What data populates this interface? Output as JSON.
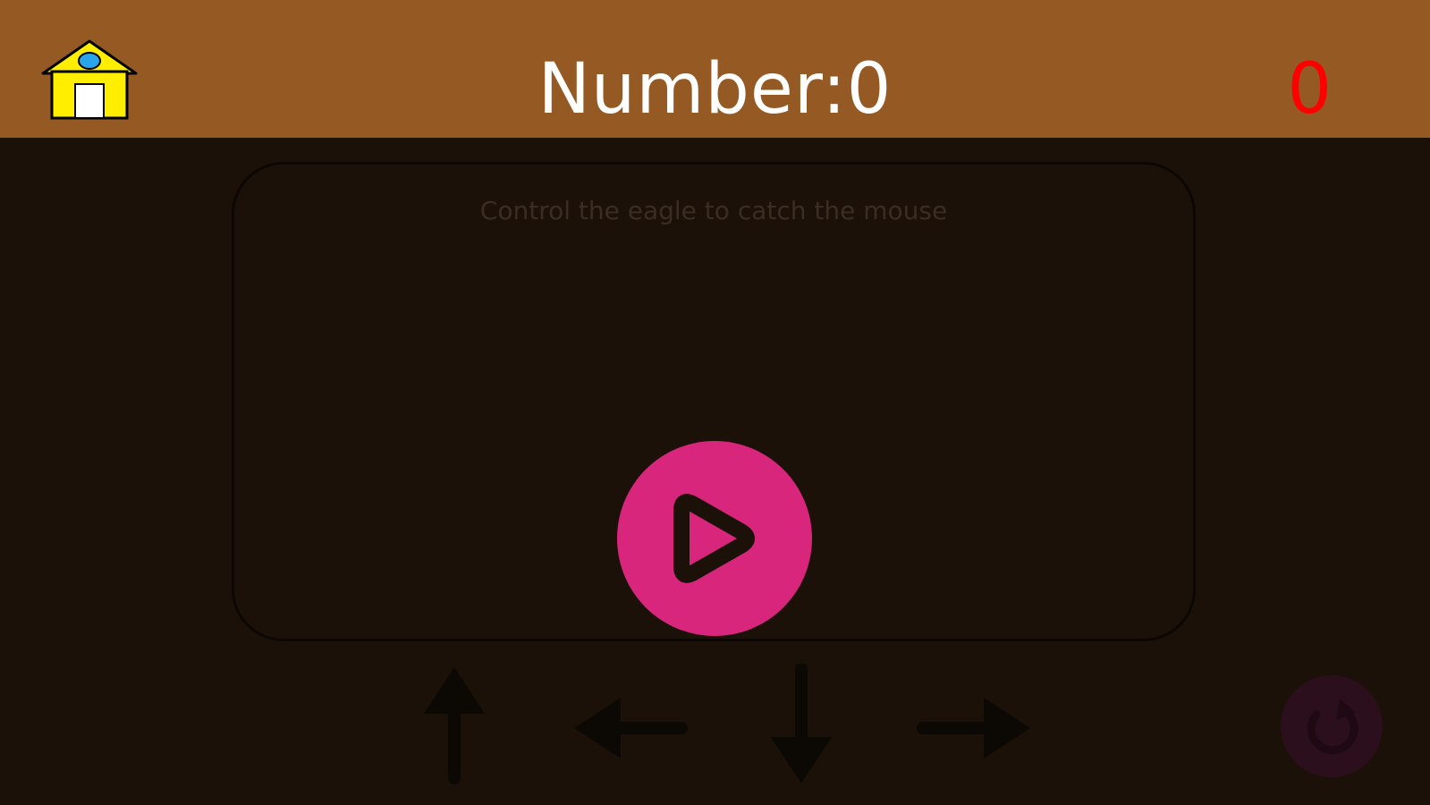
{
  "header": {
    "title": "Number:0",
    "score": "0",
    "home_icon": "home-icon"
  },
  "board": {
    "instruction": "Control the eagle to catch the mouse"
  },
  "controls": {
    "play_icon": "play-icon",
    "arrows": [
      "arrow-up-icon",
      "arrow-left-icon",
      "arrow-down-icon",
      "arrow-right-icon"
    ],
    "reset_icon": "reset-icon"
  },
  "colors": {
    "topbar": "#955a24",
    "background": "#1c1108",
    "play_button": "#d8267c",
    "score": "#ff0000"
  }
}
